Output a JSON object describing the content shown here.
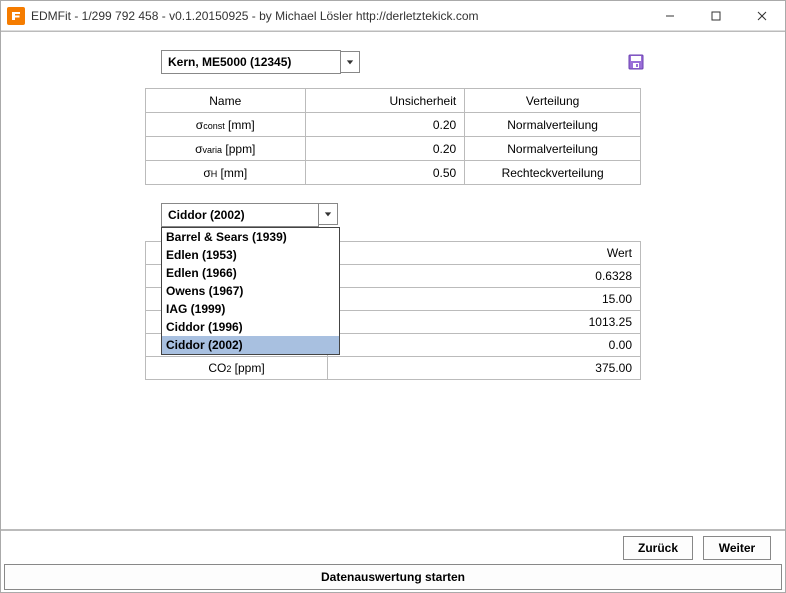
{
  "window": {
    "title": "EDMFit - 1/299 792 458 - v0.1.20150925 - by Michael Lösler http://derletztekick.com"
  },
  "instrument_combo": {
    "selected": "Kern, ME5000 (12345)"
  },
  "uncert_table": {
    "headers": {
      "name": "Name",
      "uncert": "Unsicherheit",
      "dist": "Verteilung"
    },
    "rows": [
      {
        "name_pre": "σ",
        "name_sub": "const",
        "name_unit": " [mm]",
        "value": "0.20",
        "dist": "Normalverteilung"
      },
      {
        "name_pre": "σ",
        "name_sub": "varia",
        "name_unit": " [ppm]",
        "value": "0.20",
        "dist": "Normalverteilung"
      },
      {
        "name_pre": "σ",
        "name_sub": "H",
        "name_unit": " [mm]",
        "value": "0.50",
        "dist": "Rechteckverteilung"
      }
    ]
  },
  "formula_combo": {
    "selected": "Ciddor (2002)",
    "options": [
      "Barrel & Sears (1939)",
      "Edlen (1953)",
      "Edlen (1966)",
      "Owens (1967)",
      "IAG (1999)",
      "Ciddor (1996)",
      "Ciddor (2002)"
    ]
  },
  "value_table": {
    "header_right": "Wert",
    "rows": [
      {
        "label": "",
        "value": "0.6328"
      },
      {
        "label": "",
        "value": "15.00"
      },
      {
        "label": "",
        "value": "1013.25"
      },
      {
        "label": "",
        "value": "0.00"
      },
      {
        "label_pre": "CO",
        "label_sub": "2",
        "label_unit": " [ppm]",
        "value": "375.00"
      }
    ]
  },
  "buttons": {
    "back": "Zurück",
    "next": "Weiter",
    "start": "Datenauswertung starten"
  }
}
